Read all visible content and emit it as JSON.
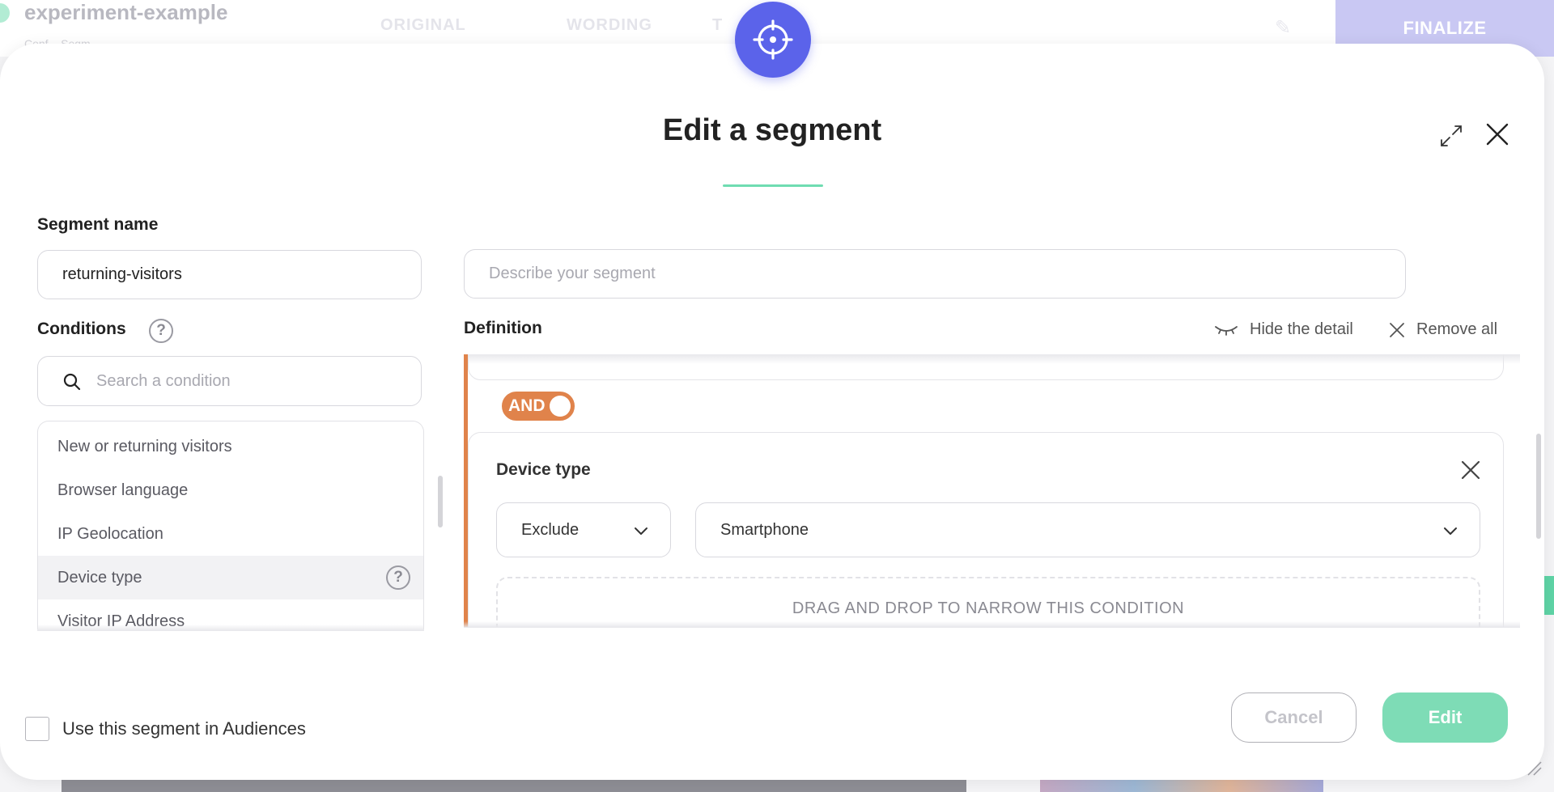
{
  "background": {
    "title": "experiment-example",
    "subtitle": "Conf... Segm...",
    "tabs": [
      "ORIGINAL",
      "WORDING",
      "T"
    ],
    "finalize_label": "FINALIZE"
  },
  "modal": {
    "title": "Edit a segment",
    "segment_name": {
      "label": "Segment name",
      "value": "returning-visitors"
    },
    "description": {
      "placeholder": "Describe your segment",
      "value": ""
    },
    "conditions": {
      "label": "Conditions",
      "help_symbol": "?",
      "search_placeholder": "Search a condition",
      "items": [
        {
          "label": "New or returning visitors"
        },
        {
          "label": "Browser language"
        },
        {
          "label": "IP Geolocation"
        },
        {
          "label": "Device type",
          "hovered": true
        },
        {
          "label": "Visitor IP Address"
        }
      ]
    },
    "definition": {
      "label": "Definition",
      "hide_detail_label": "Hide the detail",
      "remove_all_label": "Remove all",
      "operator_label": "AND",
      "condition_card": {
        "title": "Device type",
        "mode_value": "Exclude",
        "device_value": "Smartphone",
        "drop_zone_text": "DRAG AND DROP TO NARROW THIS CONDITION"
      }
    },
    "footer": {
      "audience_checkbox_label": "Use this segment in Audiences",
      "audience_checked": false,
      "cancel_label": "Cancel",
      "edit_label": "Edit"
    }
  },
  "colors": {
    "accent_purple": "#5b63ea",
    "accent_green": "#7edcb6",
    "accent_orange": "#e0834b"
  }
}
